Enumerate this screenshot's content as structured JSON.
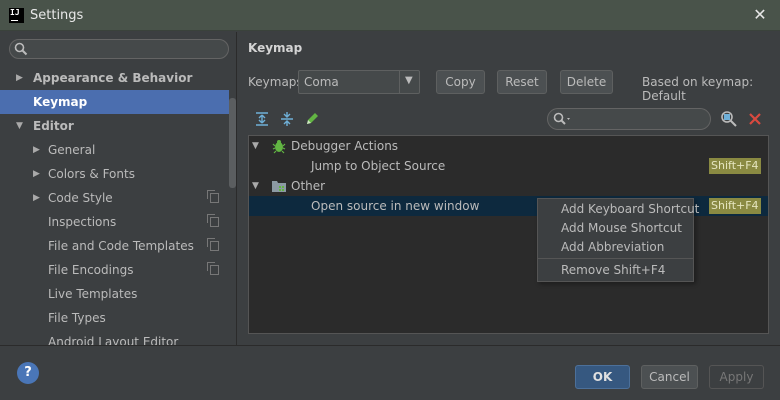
{
  "window": {
    "title": "Settings",
    "logo_text": "IJ"
  },
  "sidebar": {
    "search_placeholder": "",
    "items": [
      {
        "label": "Appearance & Behavior",
        "arrow": "▶"
      },
      {
        "label": "Keymap"
      },
      {
        "label": "Editor",
        "arrow": "▼"
      },
      {
        "label": "General",
        "arrow": "▶"
      },
      {
        "label": "Colors & Fonts",
        "arrow": "▶"
      },
      {
        "label": "Code Style",
        "arrow": "▶"
      },
      {
        "label": "Inspections"
      },
      {
        "label": "File and Code Templates"
      },
      {
        "label": "File Encodings"
      },
      {
        "label": "Live Templates"
      },
      {
        "label": "File Types"
      },
      {
        "label": "Android Layout Editor"
      }
    ]
  },
  "content": {
    "title": "Keymap",
    "keymaps_label": "Keymaps:",
    "keymap_value": "Coma",
    "buttons": {
      "copy": "Copy",
      "reset": "Reset",
      "delete": "Delete"
    },
    "based_on": "Based on keymap: Default",
    "filter_value": "",
    "tree": [
      {
        "label": "Debugger Actions",
        "arrow": "▼",
        "icon": "bug-icon"
      },
      {
        "label": "Jump to Object Source",
        "shortcut": "Shift+F4"
      },
      {
        "label": "Other",
        "arrow": "▼",
        "icon": "folder-icon"
      },
      {
        "label": "Open source in new window",
        "shortcut": "Shift+F4"
      }
    ]
  },
  "context_menu": {
    "items": [
      "Add Keyboard Shortcut",
      "Add Mouse Shortcut",
      "Add Abbreviation"
    ],
    "remove": "Remove Shift+F4"
  },
  "footer": {
    "help": "?",
    "ok": "OK",
    "cancel": "Cancel",
    "apply": "Apply"
  },
  "colors": {
    "accent": "#4b6eaf",
    "selected_row": "#0d293e",
    "shortcut_badge": "#8a8a42",
    "ok_button": "#365880",
    "delete_icon": "#d9493f",
    "edit_icon": "#62b543"
  }
}
